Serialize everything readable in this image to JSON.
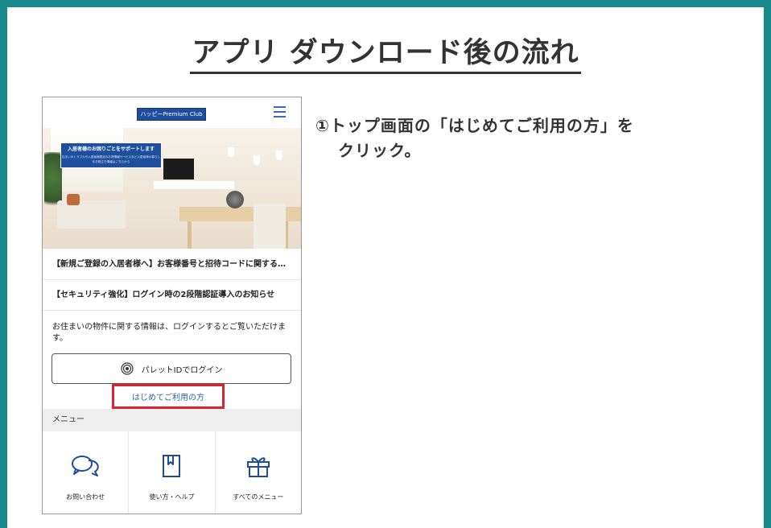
{
  "page": {
    "title": "アプリ ダウンロード後の流れ"
  },
  "app": {
    "logo": "ハッピーPremium Club",
    "hero_banner": {
      "headline": "入居者様のお困りごとをサポートします",
      "subline": "住まいのトラブルや入居者様限定のお得情報サービスなど入居者様の暮らしをお役立ち情報はこちらから"
    },
    "notices": [
      "【新規ご登録の入居者様へ】お客様番号と招待コードに関する…",
      "【セキュリティ強化】ログイン時の2段階認証導入のお知らせ"
    ],
    "info_text": "お住まいの物件に関する情報は、ログインするとご覧いただけます。",
    "login_button": "パレットIDでログイン",
    "first_time_link": "はじめてご利用の方",
    "menu_title": "メニュー",
    "menu_items": [
      {
        "icon": "chat-bubbles-icon",
        "label": "お問い合わせ"
      },
      {
        "icon": "book-icon",
        "label": "使い方・ヘルプ"
      },
      {
        "icon": "gift-icon",
        "label": "すべてのメニュー"
      }
    ]
  },
  "instruction": {
    "line1": "①トップ画面の「はじめてご利用の方」を",
    "line2": "クリック。"
  },
  "colors": {
    "frame": "#17898a",
    "brand_blue": "#1f4d9b",
    "highlight_red": "#e0212f",
    "link_blue": "#2a62b8"
  }
}
